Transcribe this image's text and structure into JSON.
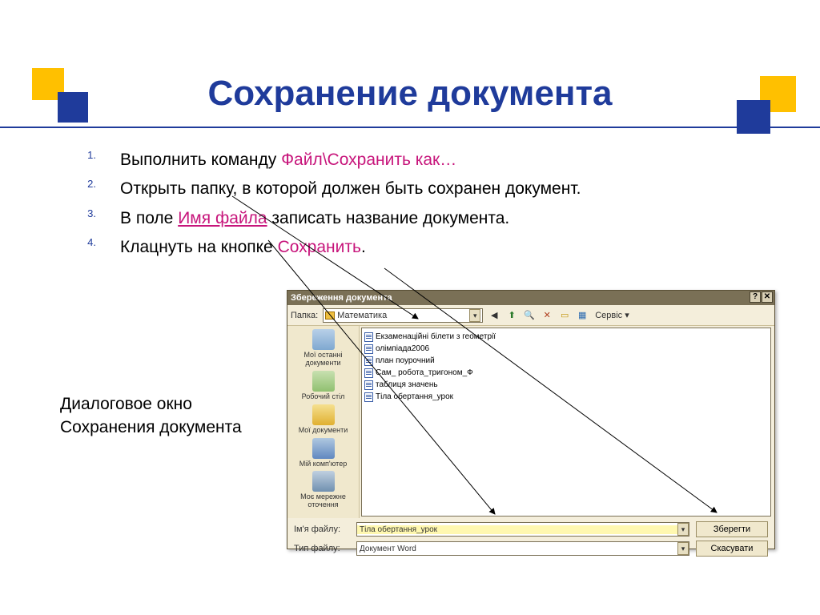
{
  "title": "Сохранение документа",
  "list": {
    "n1": "1.",
    "n2": "2.",
    "n3": "3.",
    "n4": "4.",
    "i1a": "Выполнить команду ",
    "i1b": "Файл\\Сохранить как…",
    "i2": "Открыть папку, в которой должен быть сохранен документ.",
    "i3a": "В поле ",
    "i3b": "Имя файла",
    "i3c": " записать название документа.",
    "i4a": "Клацнуть на кнопке ",
    "i4b": "Сохранить",
    "i4c": "."
  },
  "caption": {
    "l1": "Диалоговое окно",
    "l2": "Сохранения документа"
  },
  "dialog": {
    "title": "Збереження документа",
    "win": {
      "help": "?",
      "close": "✕"
    },
    "toolbar": {
      "folder_label": "Папка:",
      "folder_value": "Математика",
      "service": "Сервіс ▾"
    },
    "places": {
      "recent": "Мої останні документи",
      "desktop": "Робочий стіл",
      "mydocs": "Мої документи",
      "mycomp": "Мій комп'ютер",
      "network": "Моє мережне оточення"
    },
    "files": [
      "Екзаменаційні білети з геометрії",
      "олімпіада2006",
      "план поурочний",
      "Сам_ робота_тригоном_Ф",
      "таблиця значень",
      "Тіла обертання_урок"
    ],
    "bottom": {
      "name_label": "Ім'я файлу:",
      "name_value": "Тіла обертання_урок",
      "type_label": "Тип файлу:",
      "type_value": "Документ Word",
      "save": "Зберегти",
      "cancel": "Скасувати"
    }
  }
}
